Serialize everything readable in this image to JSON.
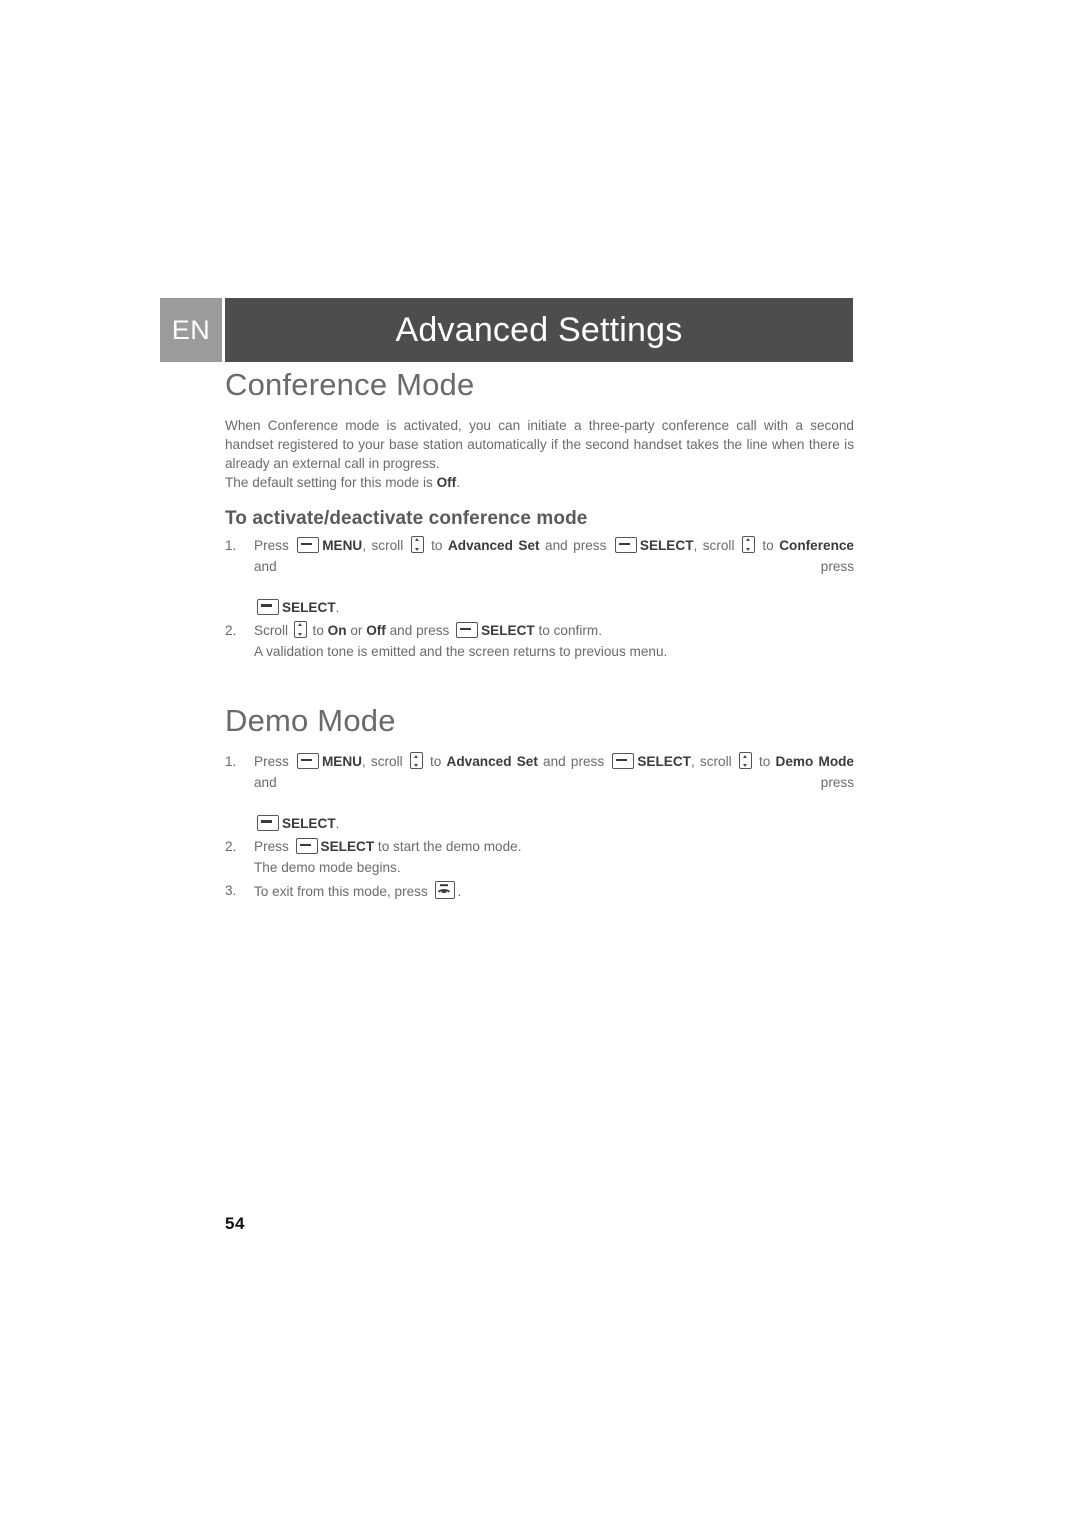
{
  "header": {
    "language_tab": "EN",
    "title": "Advanced Settings",
    "tab_color": "#9b9b9b",
    "bar_color": "#4d4d4d"
  },
  "sections": [
    {
      "title": "Conference Mode",
      "intro": "When Conference mode is activated, you can initiate a three-party conference call with a second handset registered to your base station automatically if the second handset takes the line when there is already an external call in progress.",
      "default_note_prefix": "The default setting for this mode is ",
      "default_note_value": "Off",
      "default_note_suffix": ".",
      "sub_title": "To activate/deactivate conference mode",
      "steps": [
        {
          "number": "1.",
          "line1": {
            "t1": "Press ",
            "icon1": "softkey-icon",
            "b1": "MENU",
            "t2": ", scroll ",
            "icon2": "scroll-key-icon",
            "t3": " to ",
            "b2": "Advanced Set",
            "t4": " and press ",
            "icon3": "softkey-icon",
            "b3": "SELECT",
            "t5": ", scroll ",
            "icon4": "scroll-key-icon",
            "t6": " to ",
            "b4": "Conference",
            "t7": " and press"
          },
          "line2": {
            "icon1": "softkey-icon",
            "b1": "SELECT",
            "t1": "."
          }
        },
        {
          "number": "2.",
          "line1": {
            "t1": "Scroll ",
            "icon1": "scroll-key-icon",
            "t2": " to ",
            "b1": "On",
            "t3": " or ",
            "b2": "Off",
            "t4": " and press ",
            "icon2": "softkey-icon",
            "b3": "SELECT",
            "t5": " to confirm."
          },
          "line2": {
            "t1": "A validation tone is emitted and the screen returns to previous menu."
          }
        }
      ]
    },
    {
      "title": "Demo Mode",
      "steps": [
        {
          "number": "1.",
          "line1": {
            "t1": "Press ",
            "icon1": "softkey-icon",
            "b1": "MENU",
            "t2": ", scroll ",
            "icon2": "scroll-key-icon",
            "t3": " to ",
            "b2": "Advanced Set",
            "t4": " and press ",
            "icon3": "softkey-icon",
            "b3": "SELECT",
            "t5": ", scroll ",
            "icon4": "scroll-key-icon",
            "t6": " to ",
            "b4": "Demo Mode",
            "t7": " and press"
          },
          "line2": {
            "icon1": "softkey-icon",
            "b1": "SELECT",
            "t1": "."
          }
        },
        {
          "number": "2.",
          "line1": {
            "t1": "Press ",
            "icon1": "softkey-icon",
            "b1": "SELECT",
            "t2": " to start the demo mode."
          },
          "line2": {
            "t1": "The demo mode begins."
          }
        },
        {
          "number": "3.",
          "line1": {
            "t1": "To exit from this mode, press ",
            "icon1": "end-call-key-icon",
            "t2": "."
          }
        }
      ]
    }
  ],
  "footer": {
    "page_number": "54"
  }
}
